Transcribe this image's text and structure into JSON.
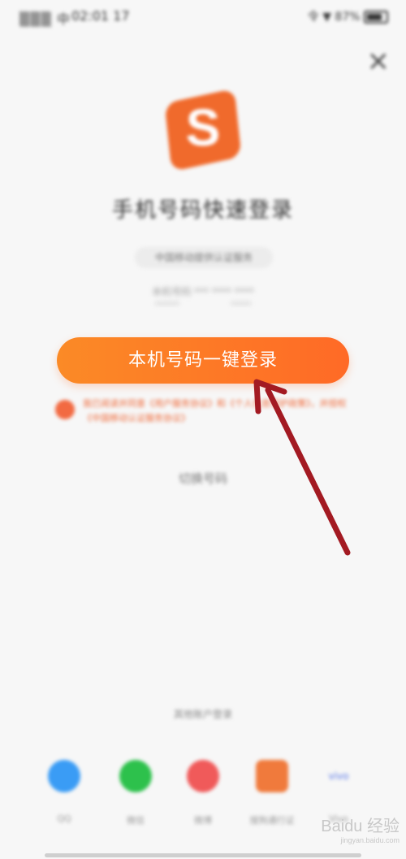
{
  "status": {
    "carrier": "▒▒▒ 中",
    "time": "02:01 17",
    "right": "令 ▼ 87%"
  },
  "close_label": "×",
  "logo_letter": "S",
  "login": {
    "title": "手机号码快速登录",
    "operator": "中国移动提供认证服务",
    "phone_line": "本机号码 *** **** ****",
    "phone_line2": "****** *****",
    "button": "本机号码一键登录",
    "agreement": "我已阅读并同意《用户服务协议》和《个人信息保护政策》，并授权《中国移动认证服务协议》",
    "switch": "切换号码"
  },
  "other": {
    "title": "其他账户登录",
    "items": [
      {
        "label": "QQ",
        "icon": "qq-icon",
        "color": "#3a9cf5"
      },
      {
        "label": "微信",
        "icon": "wechat-icon",
        "color": "#2dc14c"
      },
      {
        "label": "微博",
        "icon": "weibo-icon",
        "color": "#f05a5a"
      },
      {
        "label": "搜狗通行证",
        "icon": "sogou-passport-icon",
        "color": "#f07a3c"
      },
      {
        "label": "Vivo",
        "icon": "vivo-icon",
        "color": "#5a79e8"
      }
    ]
  },
  "colors": {
    "accent": "#ff7a26",
    "arrow": "#a31a22"
  },
  "watermark": {
    "brand": "Baidu 经验",
    "url": "jingyan.baidu.com"
  }
}
